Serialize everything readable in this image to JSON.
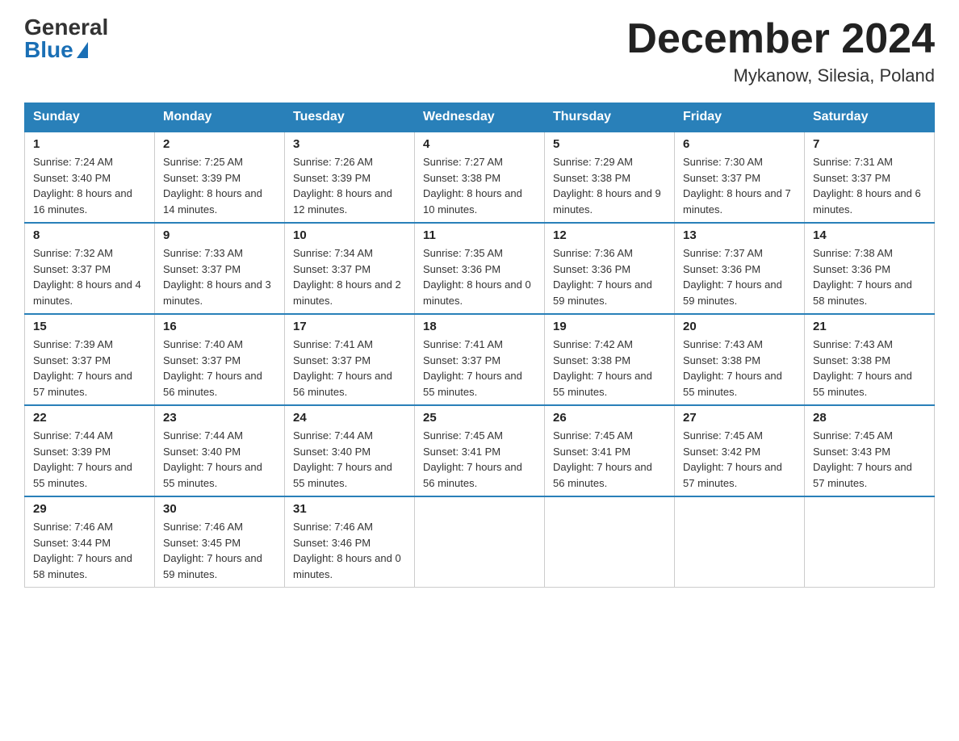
{
  "logo": {
    "general": "General",
    "blue": "Blue"
  },
  "title": "December 2024",
  "location": "Mykanow, Silesia, Poland",
  "days_of_week": [
    "Sunday",
    "Monday",
    "Tuesday",
    "Wednesday",
    "Thursday",
    "Friday",
    "Saturday"
  ],
  "weeks": [
    [
      {
        "day": "1",
        "sunrise": "7:24 AM",
        "sunset": "3:40 PM",
        "daylight": "8 hours and 16 minutes."
      },
      {
        "day": "2",
        "sunrise": "7:25 AM",
        "sunset": "3:39 PM",
        "daylight": "8 hours and 14 minutes."
      },
      {
        "day": "3",
        "sunrise": "7:26 AM",
        "sunset": "3:39 PM",
        "daylight": "8 hours and 12 minutes."
      },
      {
        "day": "4",
        "sunrise": "7:27 AM",
        "sunset": "3:38 PM",
        "daylight": "8 hours and 10 minutes."
      },
      {
        "day": "5",
        "sunrise": "7:29 AM",
        "sunset": "3:38 PM",
        "daylight": "8 hours and 9 minutes."
      },
      {
        "day": "6",
        "sunrise": "7:30 AM",
        "sunset": "3:37 PM",
        "daylight": "8 hours and 7 minutes."
      },
      {
        "day": "7",
        "sunrise": "7:31 AM",
        "sunset": "3:37 PM",
        "daylight": "8 hours and 6 minutes."
      }
    ],
    [
      {
        "day": "8",
        "sunrise": "7:32 AM",
        "sunset": "3:37 PM",
        "daylight": "8 hours and 4 minutes."
      },
      {
        "day": "9",
        "sunrise": "7:33 AM",
        "sunset": "3:37 PM",
        "daylight": "8 hours and 3 minutes."
      },
      {
        "day": "10",
        "sunrise": "7:34 AM",
        "sunset": "3:37 PM",
        "daylight": "8 hours and 2 minutes."
      },
      {
        "day": "11",
        "sunrise": "7:35 AM",
        "sunset": "3:36 PM",
        "daylight": "8 hours and 0 minutes."
      },
      {
        "day": "12",
        "sunrise": "7:36 AM",
        "sunset": "3:36 PM",
        "daylight": "7 hours and 59 minutes."
      },
      {
        "day": "13",
        "sunrise": "7:37 AM",
        "sunset": "3:36 PM",
        "daylight": "7 hours and 59 minutes."
      },
      {
        "day": "14",
        "sunrise": "7:38 AM",
        "sunset": "3:36 PM",
        "daylight": "7 hours and 58 minutes."
      }
    ],
    [
      {
        "day": "15",
        "sunrise": "7:39 AM",
        "sunset": "3:37 PM",
        "daylight": "7 hours and 57 minutes."
      },
      {
        "day": "16",
        "sunrise": "7:40 AM",
        "sunset": "3:37 PM",
        "daylight": "7 hours and 56 minutes."
      },
      {
        "day": "17",
        "sunrise": "7:41 AM",
        "sunset": "3:37 PM",
        "daylight": "7 hours and 56 minutes."
      },
      {
        "day": "18",
        "sunrise": "7:41 AM",
        "sunset": "3:37 PM",
        "daylight": "7 hours and 55 minutes."
      },
      {
        "day": "19",
        "sunrise": "7:42 AM",
        "sunset": "3:38 PM",
        "daylight": "7 hours and 55 minutes."
      },
      {
        "day": "20",
        "sunrise": "7:43 AM",
        "sunset": "3:38 PM",
        "daylight": "7 hours and 55 minutes."
      },
      {
        "day": "21",
        "sunrise": "7:43 AM",
        "sunset": "3:38 PM",
        "daylight": "7 hours and 55 minutes."
      }
    ],
    [
      {
        "day": "22",
        "sunrise": "7:44 AM",
        "sunset": "3:39 PM",
        "daylight": "7 hours and 55 minutes."
      },
      {
        "day": "23",
        "sunrise": "7:44 AM",
        "sunset": "3:40 PM",
        "daylight": "7 hours and 55 minutes."
      },
      {
        "day": "24",
        "sunrise": "7:44 AM",
        "sunset": "3:40 PM",
        "daylight": "7 hours and 55 minutes."
      },
      {
        "day": "25",
        "sunrise": "7:45 AM",
        "sunset": "3:41 PM",
        "daylight": "7 hours and 56 minutes."
      },
      {
        "day": "26",
        "sunrise": "7:45 AM",
        "sunset": "3:41 PM",
        "daylight": "7 hours and 56 minutes."
      },
      {
        "day": "27",
        "sunrise": "7:45 AM",
        "sunset": "3:42 PM",
        "daylight": "7 hours and 57 minutes."
      },
      {
        "day": "28",
        "sunrise": "7:45 AM",
        "sunset": "3:43 PM",
        "daylight": "7 hours and 57 minutes."
      }
    ],
    [
      {
        "day": "29",
        "sunrise": "7:46 AM",
        "sunset": "3:44 PM",
        "daylight": "7 hours and 58 minutes."
      },
      {
        "day": "30",
        "sunrise": "7:46 AM",
        "sunset": "3:45 PM",
        "daylight": "7 hours and 59 minutes."
      },
      {
        "day": "31",
        "sunrise": "7:46 AM",
        "sunset": "3:46 PM",
        "daylight": "8 hours and 0 minutes."
      },
      null,
      null,
      null,
      null
    ]
  ]
}
